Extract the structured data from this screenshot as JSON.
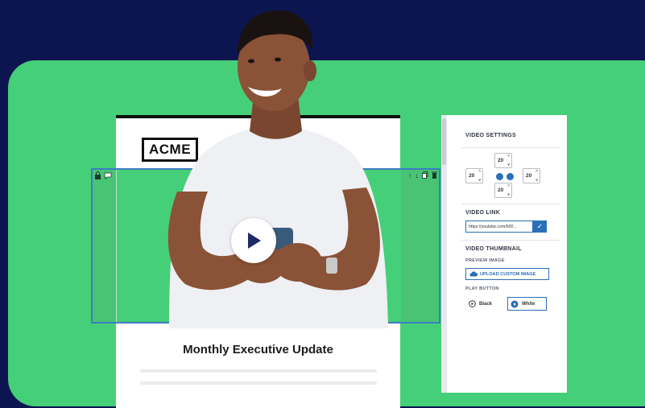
{
  "email": {
    "logo": "ACME",
    "headline": "Monthly Executive Update"
  },
  "video_block": {
    "left_icons": [
      "lock-icon",
      "comment-icon"
    ],
    "right_icons": [
      "arrow-up-icon",
      "arrow-down-icon",
      "copy-icon",
      "trash-icon"
    ],
    "play_icon": "play-icon"
  },
  "settings": {
    "video_settings_title": "VIDEO SETTINGS",
    "padding": {
      "top": "20",
      "left": "20",
      "right": "20",
      "bottom": "20"
    },
    "video_link_title": "VIDEO LINK",
    "video_link_value": "https://youtube.com/600...",
    "video_thumbnail_title": "VIDEO THUMBNAIL",
    "preview_image_label": "PREVIEW IMAGE",
    "upload_label": "UPLOAD CUSTOM IMAGE",
    "play_button_label": "PLAY BUTTON",
    "option_black": "Black",
    "option_white": "White"
  },
  "colors": {
    "background": "#0d1550",
    "green": "#45cf78",
    "accent_blue": "#2a6fb8"
  }
}
